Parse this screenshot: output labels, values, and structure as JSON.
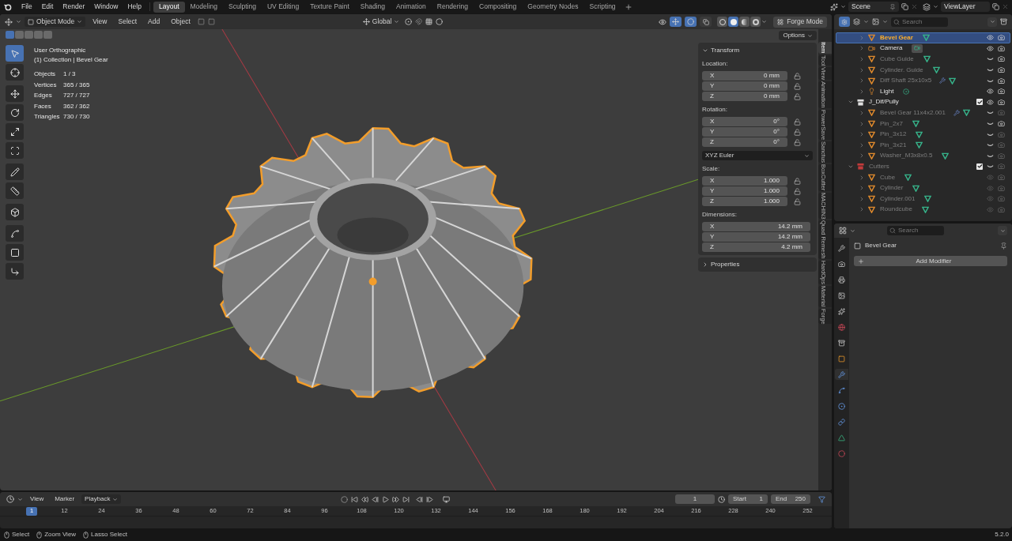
{
  "top_menu": [
    "File",
    "Edit",
    "Render",
    "Window",
    "Help"
  ],
  "workspaces": [
    {
      "label": "Layout",
      "selected": true
    },
    {
      "label": "Modeling",
      "selected": false
    },
    {
      "label": "Sculpting",
      "selected": false
    },
    {
      "label": "UV Editing",
      "selected": false
    },
    {
      "label": "Texture Paint",
      "selected": false
    },
    {
      "label": "Shading",
      "selected": false
    },
    {
      "label": "Animation",
      "selected": false
    },
    {
      "label": "Rendering",
      "selected": false
    },
    {
      "label": "Compositing",
      "selected": false
    },
    {
      "label": "Geometry Nodes",
      "selected": false
    },
    {
      "label": "Scripting",
      "selected": false
    }
  ],
  "scene": "Scene",
  "view_layer": "ViewLayer",
  "viewport_header": {
    "mode": "Object Mode",
    "menus": [
      "View",
      "Select",
      "Add",
      "Object"
    ],
    "orientation": "Global",
    "toggles": [
      {
        "kind": "gizmo",
        "on": true
      },
      {
        "kind": "overlay",
        "on": true
      },
      {
        "kind": "xray",
        "on": false
      }
    ],
    "shading": [
      {
        "kind": "wireframe",
        "selected": false
      },
      {
        "kind": "solid",
        "selected": true
      },
      {
        "kind": "material",
        "selected": false
      },
      {
        "kind": "rendered",
        "selected": false
      }
    ],
    "forge_button": "Forge Mode"
  },
  "select_modes": [
    {
      "selected": true
    },
    {
      "selected": false
    },
    {
      "selected": false
    },
    {
      "selected": false
    },
    {
      "selected": false
    }
  ],
  "tools": [
    {
      "kind": "select",
      "selected": true
    },
    {
      "kind": "cursor",
      "selected": false
    },
    {
      "kind": "move",
      "selected": false
    },
    {
      "kind": "rotate",
      "selected": false
    },
    {
      "kind": "scale",
      "selected": false
    },
    {
      "kind": "transform",
      "selected": false
    },
    {
      "kind": "annotate",
      "selected": false
    },
    {
      "kind": "measure",
      "selected": false
    },
    {
      "kind": "add_cube",
      "selected": false
    },
    {
      "kind": "curve",
      "selected": false
    },
    {
      "kind": "square",
      "selected": false
    },
    {
      "kind": "corner",
      "selected": false
    }
  ],
  "viewport_info": {
    "view": "User Orthographic",
    "context": "(1) Collection | Bevel Gear",
    "stats": [
      {
        "label": "Objects",
        "value": "1 / 3"
      },
      {
        "label": "Vertices",
        "value": "365 / 365"
      },
      {
        "label": "Edges",
        "value": "727 / 727"
      },
      {
        "label": "Faces",
        "value": "362 / 362"
      },
      {
        "label": "Triangles",
        "value": "730 / 730"
      }
    ]
  },
  "options_button": "Options",
  "transform_panel": {
    "title": "Transform",
    "expanded": true,
    "location": {
      "label": "Location:",
      "fields": [
        {
          "axis": "X",
          "value": "0 mm",
          "locked": false
        },
        {
          "axis": "Y",
          "value": "0 mm",
          "locked": false
        },
        {
          "axis": "Z",
          "value": "0 mm",
          "locked": false
        }
      ]
    },
    "rotation": {
      "label": "Rotation:",
      "fields": [
        {
          "axis": "X",
          "value": "0°",
          "locked": false
        },
        {
          "axis": "Y",
          "value": "0°",
          "locked": false
        },
        {
          "axis": "Z",
          "value": "0°",
          "locked": false
        }
      ]
    },
    "rotation_mode": "XYZ Euler",
    "scale": {
      "label": "Scale:",
      "fields": [
        {
          "axis": "X",
          "value": "1.000",
          "locked": false
        },
        {
          "axis": "Y",
          "value": "1.000",
          "locked": false
        },
        {
          "axis": "Z",
          "value": "1.000",
          "locked": false
        }
      ]
    },
    "dimensions": {
      "label": "Dimensions:",
      "fields": [
        {
          "axis": "X",
          "value": "14.2 mm"
        },
        {
          "axis": "Y",
          "value": "14.2 mm"
        },
        {
          "axis": "Z",
          "value": "4.2 mm"
        }
      ]
    }
  },
  "properties_panel": {
    "title": "Properties",
    "expanded": false
  },
  "side_tabs": [
    {
      "label": "Item",
      "selected": true
    },
    {
      "label": "Tool",
      "selected": false
    },
    {
      "label": "View",
      "selected": false
    },
    {
      "label": "Animation",
      "selected": false
    },
    {
      "label": "PowerSave",
      "selected": false
    },
    {
      "label": "Sanctus",
      "selected": false
    },
    {
      "label": "BoxCutter",
      "selected": false
    },
    {
      "label": "MACHIN3",
      "selected": false
    },
    {
      "label": "Quad Remesh",
      "selected": false
    },
    {
      "label": "HardOps",
      "selected": false
    },
    {
      "label": "Material",
      "selected": false
    },
    {
      "label": "Forge",
      "selected": false
    }
  ],
  "outliner": {
    "search_placeholder": "Search",
    "items": [
      {
        "name": "Bevel Gear",
        "kind": "mesh",
        "selected": true,
        "hidden": false,
        "renderable": true,
        "modifier": false
      },
      {
        "name": "Camera",
        "kind": "camera",
        "selected": false,
        "hidden": false,
        "renderable": true,
        "modifier": false
      },
      {
        "name": "Cube Guide",
        "kind": "mesh",
        "selected": false,
        "hidden": true,
        "renderable": true,
        "modifier": false
      },
      {
        "name": "Cylinder. Guide",
        "kind": "mesh",
        "selected": false,
        "hidden": true,
        "renderable": true,
        "modifier": false
      },
      {
        "name": "Diff Shaft 25x10x5",
        "kind": "mesh",
        "selected": false,
        "hidden": true,
        "renderable": true,
        "modifier": true
      },
      {
        "name": "Light",
        "kind": "light",
        "selected": false,
        "hidden": false,
        "renderable": true,
        "modifier": false
      },
      {
        "name": "J_Dif/Pully",
        "kind": "collection",
        "color": "#e0e0e0",
        "selected": false,
        "expanded": true,
        "checked": true,
        "disabled": false,
        "hidden": false,
        "renderable": true,
        "children": [
          {
            "name": "Bevel Gear 11x4x2.001",
            "kind": "mesh",
            "selected": false,
            "hidden": true,
            "renderable": false,
            "modifier": true
          },
          {
            "name": "Pin_2x7",
            "kind": "mesh",
            "selected": false,
            "hidden": true,
            "renderable": true,
            "modifier": false
          },
          {
            "name": "Pin_3x12",
            "kind": "mesh",
            "selected": false,
            "hidden": true,
            "renderable": false,
            "modifier": false
          },
          {
            "name": "Pin_3x21",
            "kind": "mesh",
            "selected": false,
            "hidden": true,
            "renderable": false,
            "modifier": false
          },
          {
            "name": "Washer_M3x8x0.5",
            "kind": "mesh",
            "selected": false,
            "hidden": true,
            "renderable": false,
            "modifier": false
          }
        ]
      },
      {
        "name": "Cutters",
        "kind": "collection",
        "color": "#c23b3b",
        "selected": false,
        "expanded": true,
        "checked": true,
        "disabled": true,
        "hidden": true,
        "renderable": false,
        "children": [
          {
            "name": "Cube",
            "kind": "mesh",
            "selected": false,
            "hidden": false,
            "renderable": false,
            "modifier": false
          },
          {
            "name": "Cylinder",
            "kind": "mesh",
            "selected": false,
            "hidden": false,
            "renderable": false,
            "modifier": false
          },
          {
            "name": "Cylinder.001",
            "kind": "mesh",
            "selected": false,
            "hidden": false,
            "renderable": false,
            "modifier": false
          },
          {
            "name": "Roundcube",
            "kind": "mesh",
            "selected": false,
            "hidden": false,
            "renderable": false,
            "modifier": false
          }
        ]
      }
    ]
  },
  "properties_editor": {
    "search_placeholder": "Search",
    "object_name": "Bevel Gear",
    "add_modifier": "Add Modifier",
    "tabs": [
      {
        "kind": "tool",
        "selected": false
      },
      {
        "kind": "render",
        "selected": false
      },
      {
        "kind": "output",
        "selected": false
      },
      {
        "kind": "view_layer",
        "selected": false
      },
      {
        "kind": "scene",
        "selected": false
      },
      {
        "kind": "world",
        "selected": false
      },
      {
        "kind": "collection",
        "selected": false
      },
      {
        "kind": "object",
        "selected": false
      },
      {
        "kind": "modifiers",
        "selected": true
      },
      {
        "kind": "particles",
        "selected": false
      },
      {
        "kind": "physics",
        "selected": false
      },
      {
        "kind": "constraints",
        "selected": false
      },
      {
        "kind": "data",
        "selected": false
      },
      {
        "kind": "material",
        "selected": false
      }
    ]
  },
  "timeline": {
    "menus": [
      "View",
      "Marker"
    ],
    "playback": "Playback",
    "current_frame": "1",
    "start_label": "Start",
    "start": "1",
    "end_label": "End",
    "end": "250",
    "marker": "1",
    "ruler": [
      "12",
      "24",
      "36",
      "48",
      "60",
      "72",
      "84",
      "96",
      "108",
      "120",
      "132",
      "144",
      "156",
      "168",
      "180",
      "192",
      "204",
      "216",
      "228",
      "240",
      "252"
    ]
  },
  "status_bar": {
    "hints": [
      "Select",
      "Zoom View",
      "Lasso Select"
    ],
    "version": "5.2.0"
  }
}
